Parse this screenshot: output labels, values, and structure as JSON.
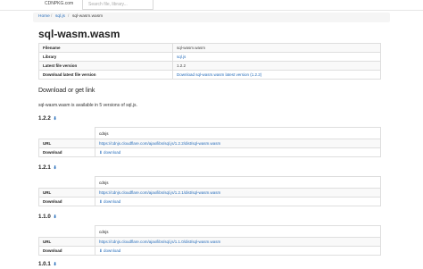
{
  "header": {
    "brand": "CDNPKG.com",
    "search_placeholder": "Search file, library..."
  },
  "breadcrumb": [
    "Home",
    "sql.js",
    "sql-wasm.wasm"
  ],
  "page_title": "sql-wasm.wasm",
  "info": [
    {
      "key": "Filename",
      "value": "sql-wasm.wasm"
    },
    {
      "key": "Library",
      "value": "sql.js"
    },
    {
      "key": "Latest file version",
      "value": "1.2.2"
    },
    {
      "key": "Download latest file version",
      "value": "Download sql-wasm.wasm latest version (1.2.2)"
    }
  ],
  "download_heading": "Download or get link",
  "availability": "sql-wasm.wasm is available in 5 versions of sql.js.",
  "versions": [
    {
      "version": "1.2.2",
      "cdn": "cdnjs",
      "url_label": "URL",
      "url": "https://cdnjs.cloudflare.com/ajax/libs/sql.js/1.2.2/dist/sql-wasm.wasm",
      "download_label": "Download",
      "download_text": "download"
    },
    {
      "version": "1.2.1",
      "cdn": "cdnjs",
      "url_label": "URL",
      "url": "https://cdnjs.cloudflare.com/ajax/libs/sql.js/1.2.1/dist/sql-wasm.wasm",
      "download_label": "Download",
      "download_text": "download"
    },
    {
      "version": "1.1.0",
      "cdn": "cdnjs",
      "url_label": "URL",
      "url": "https://cdnjs.cloudflare.com/ajax/libs/sql.js/1.1.0/dist/sql-wasm.wasm",
      "download_label": "Download",
      "download_text": "download"
    },
    {
      "version": "1.0.1"
    }
  ],
  "icons": {
    "download": "download-icon"
  }
}
